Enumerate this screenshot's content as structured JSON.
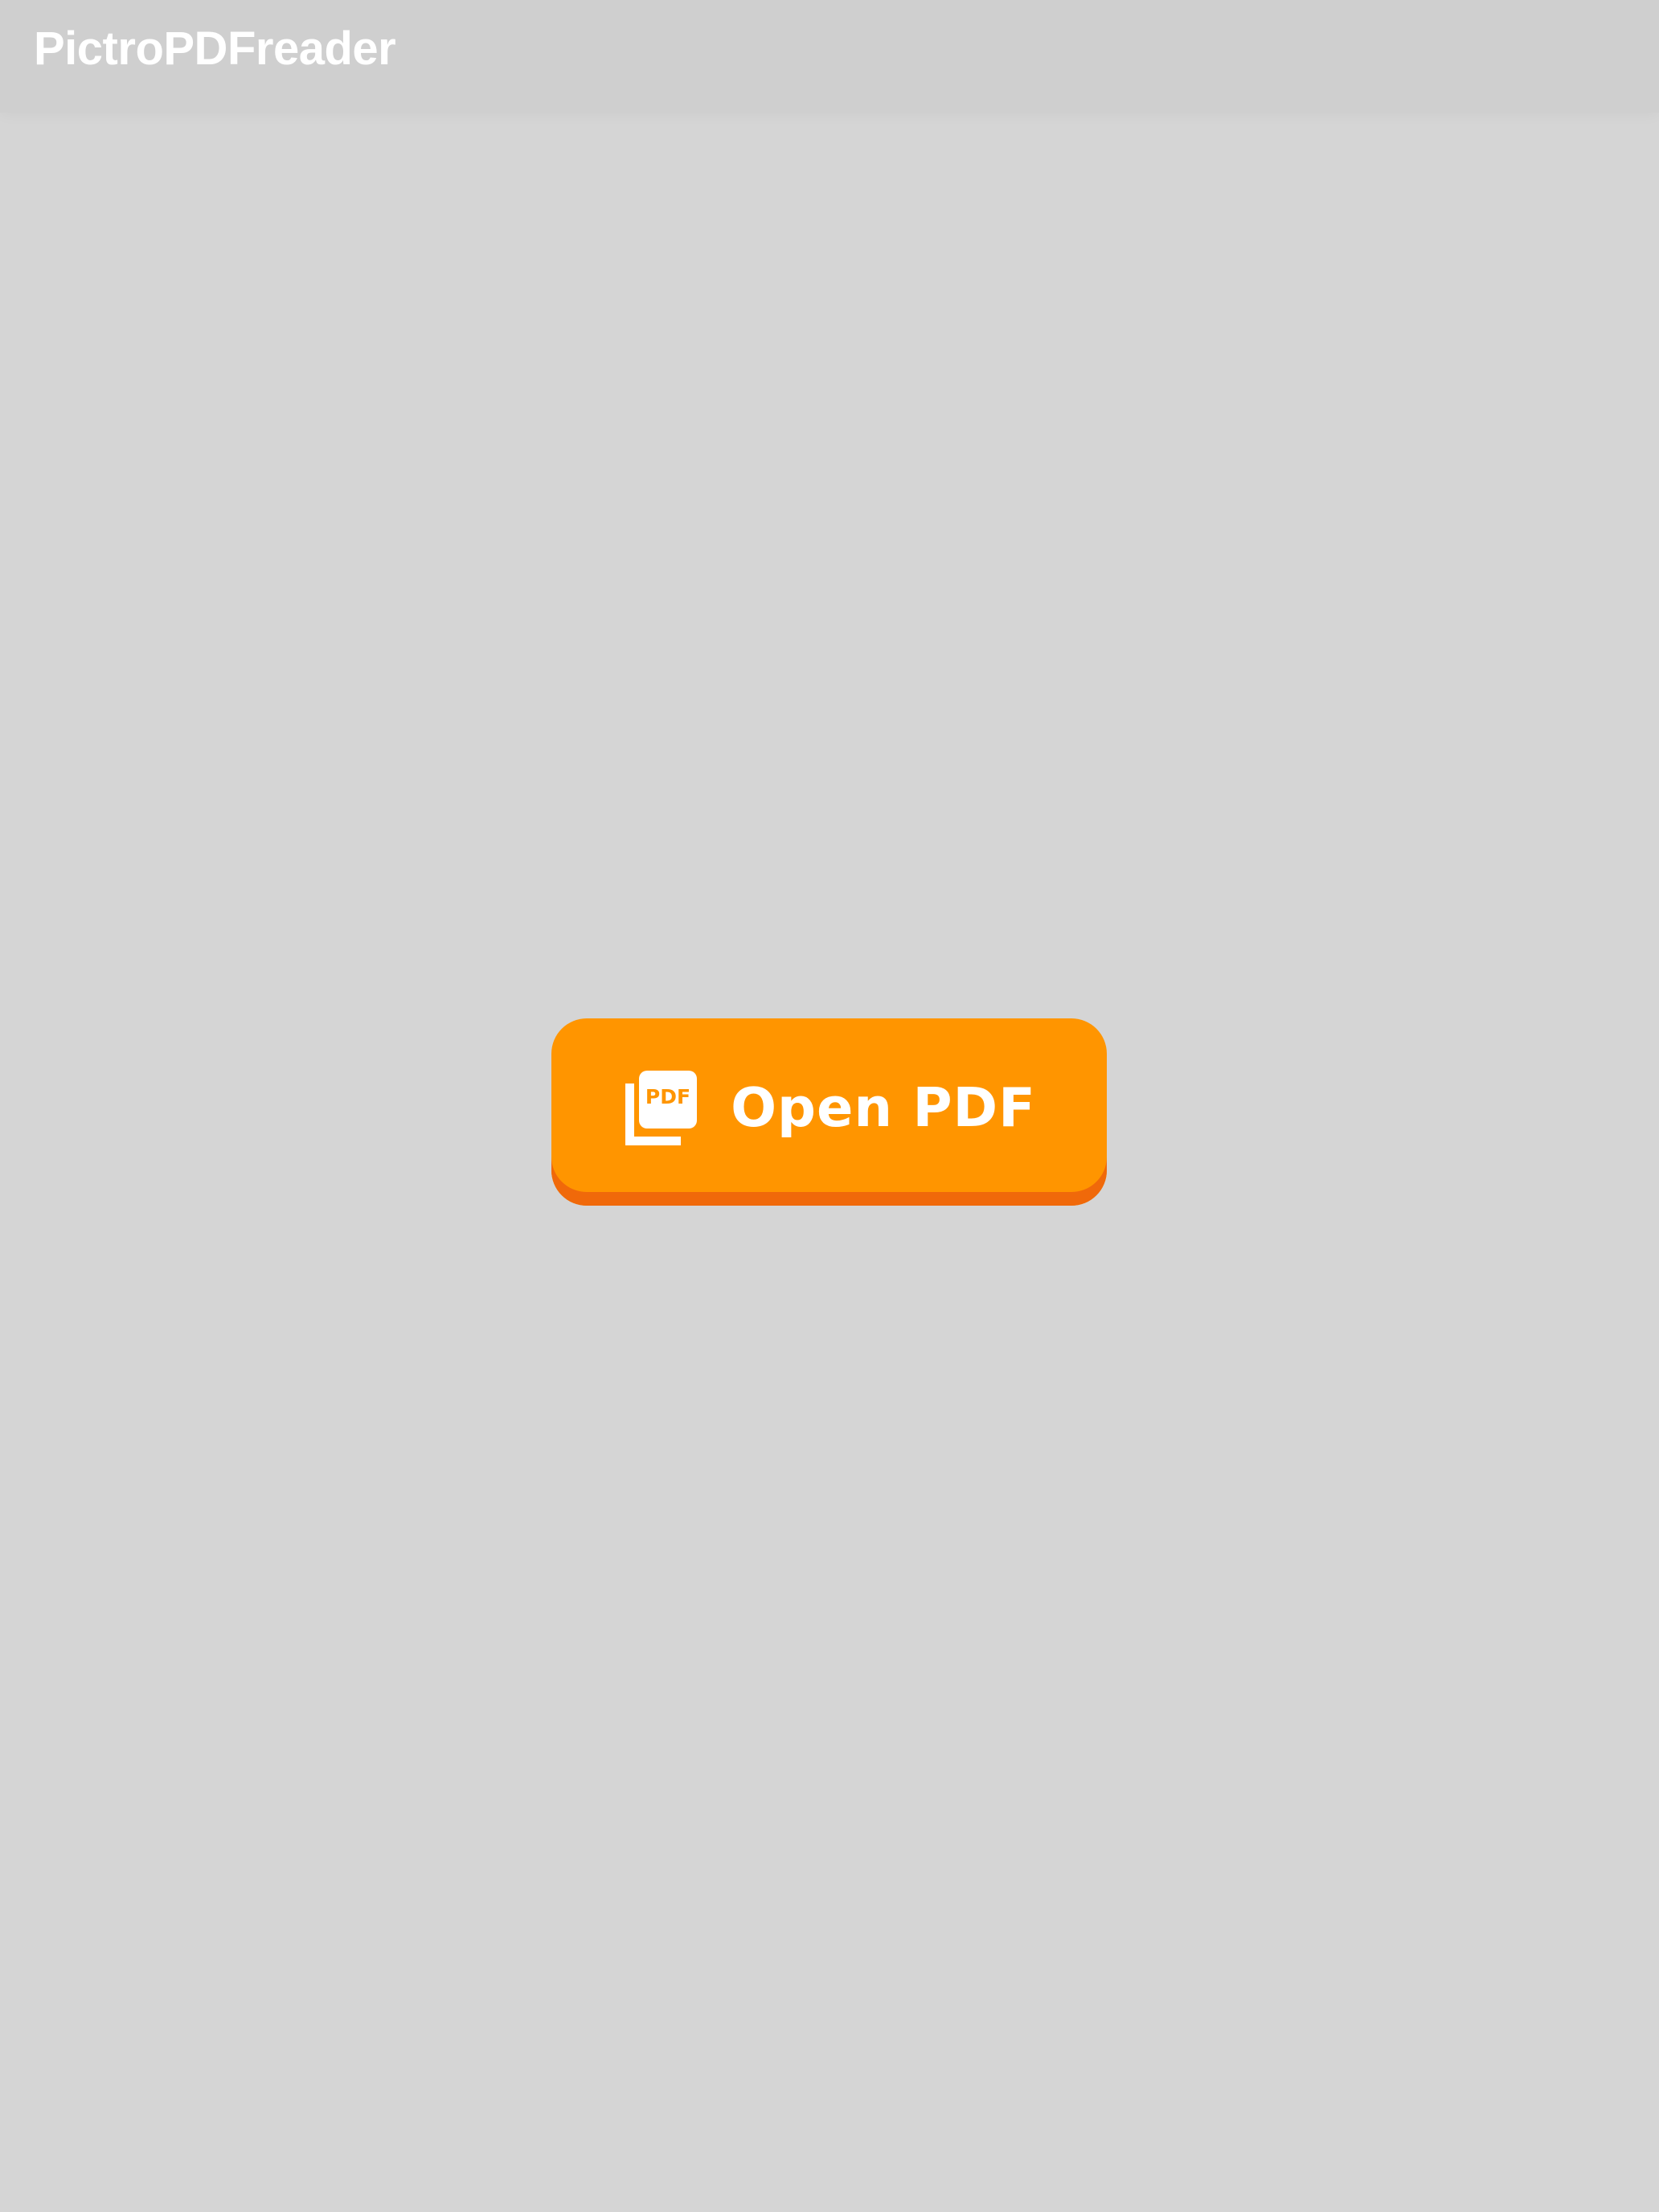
{
  "app": {
    "title": "PictroPDFreader"
  },
  "main": {
    "open_button": {
      "label": "Open PDF",
      "icon": "pdf-documents-icon",
      "icon_text": "PDF"
    }
  },
  "colors": {
    "background": "#d5d5d5",
    "header": "#cfcfcf",
    "button": "#ff9500",
    "button_shadow": "#f0690a",
    "text": "#ffffff"
  }
}
